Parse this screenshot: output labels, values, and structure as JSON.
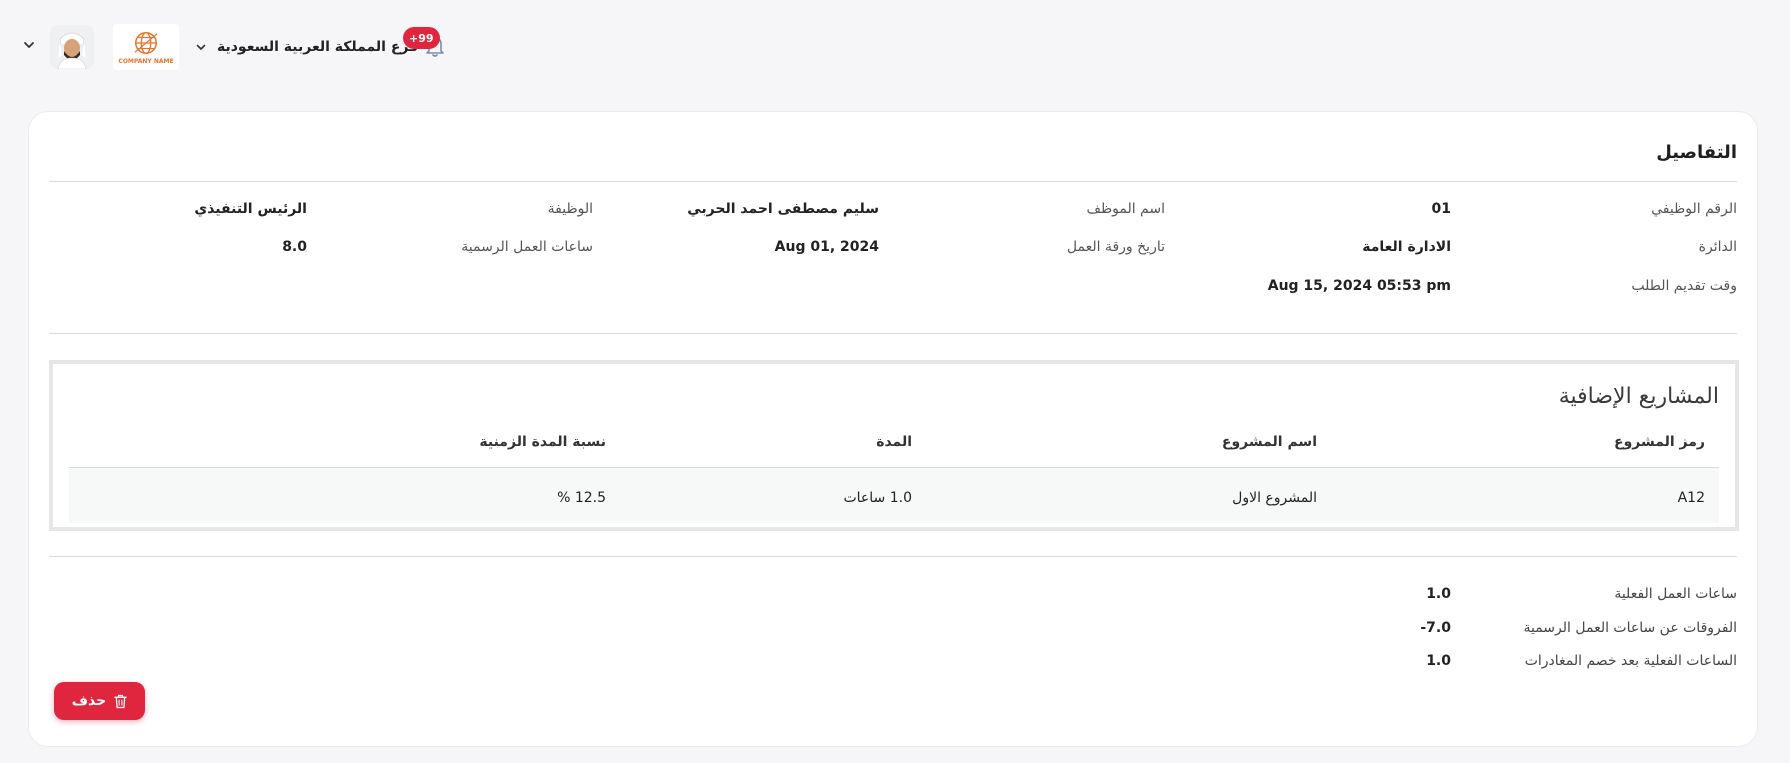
{
  "header": {
    "branch_label": "فرع المملكة العربية السعودية",
    "notifications_badge": "+99",
    "company_logo_text": "COMPANY NAME"
  },
  "details": {
    "title": "التفاصيل",
    "employee_number_label": "الرقم الوظيفي",
    "employee_number_value": "01",
    "employee_name_label": "اسم الموظف",
    "employee_name_value": "سليم مصطفى احمد الحربي",
    "job_label": "الوظيفة",
    "job_value": "الرئيس التنفيذي",
    "department_label": "الدائرة",
    "department_value": "الادارة العامة",
    "worksheet_date_label": "تاريخ ورقة العمل",
    "worksheet_date_value": "Aug 01, 2024",
    "official_hours_label": "ساعات العمل الرسمية",
    "official_hours_value": "8.0",
    "submission_time_label": "وقت تقديم الطلب",
    "submission_time_value": "Aug 15, 2024 05:53 pm"
  },
  "projects": {
    "title": "المشاريع الإضافية",
    "columns": {
      "code": "رمز المشروع",
      "name": "اسم المشروع",
      "duration": "المدة",
      "ratio": "نسبة المدة الزمنية"
    },
    "rows": [
      {
        "code": "A12",
        "name": "المشروع الاول",
        "duration": "1.0 ساعات",
        "ratio": "12.5 %"
      }
    ]
  },
  "summary": {
    "actual_hours_label": "ساعات العمل الفعلية",
    "actual_hours_value": "1.0",
    "diff_label": "الفروقات عن ساعات العمل الرسمية",
    "diff_value": "-7.0",
    "net_hours_label": "الساعات الفعلية بعد خصم المغادرات",
    "net_hours_value": "1.0"
  },
  "actions": {
    "delete_label": "حذف"
  },
  "colors": {
    "accent": "#e0263f",
    "background": "#f6f6f9",
    "logo_orange": "#e8732a"
  },
  "icons": [
    "chevron-down-icon",
    "avatar",
    "company-logo",
    "bell-icon",
    "trash-icon"
  ]
}
